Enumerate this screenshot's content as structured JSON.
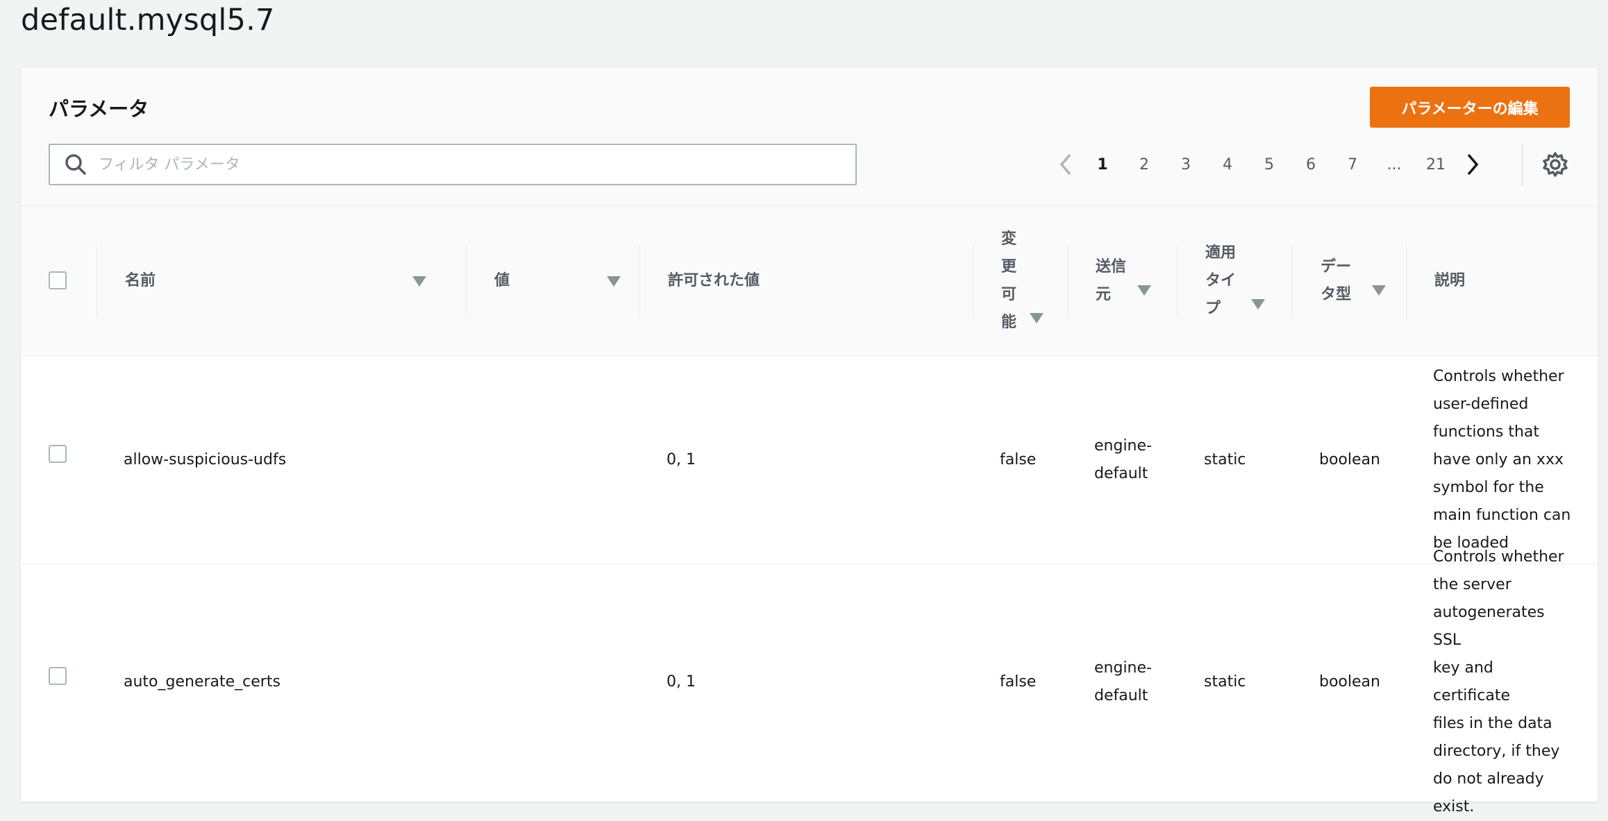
{
  "page": {
    "title": "default.mysql5.7"
  },
  "panel": {
    "title": "パラメータ",
    "edit_button": "パラメーターの編集",
    "search": {
      "placeholder": "フィルタ パラメータ",
      "value": ""
    },
    "pagination": {
      "pages": [
        "1",
        "2",
        "3",
        "4",
        "5",
        "6",
        "7",
        "...",
        "21"
      ],
      "current": "1"
    }
  },
  "table": {
    "columns": {
      "name": "名前",
      "value": "値",
      "allowed": "許可された値",
      "modifiable": [
        "変",
        "更",
        "可",
        "能"
      ],
      "source": [
        "送信",
        "元"
      ],
      "apply_type": [
        "適用",
        "タイ",
        "プ"
      ],
      "data_type": [
        "デー",
        "タ型"
      ],
      "description": "説明"
    },
    "rows": [
      {
        "name": "allow-suspicious-udfs",
        "value": "",
        "allowed": "0, 1",
        "modifiable": "false",
        "source": [
          "engine-",
          "default"
        ],
        "apply_type": "static",
        "data_type": "boolean",
        "description": [
          "Controls whether",
          "user-defined",
          "functions that",
          "have only an xxx",
          "symbol for the",
          "main function can",
          "be loaded"
        ]
      },
      {
        "name": "auto_generate_certs",
        "value": "",
        "allowed": "0, 1",
        "modifiable": "false",
        "source": [
          "engine-",
          "default"
        ],
        "apply_type": "static",
        "data_type": "boolean",
        "description": [
          "Controls whether",
          "the server",
          "autogenerates SSL",
          "key and certificate",
          "files in the data",
          "directory, if they",
          "do not already",
          "exist."
        ]
      }
    ]
  },
  "colors": {
    "accent": "#ec7211",
    "sort_icon": "#879596"
  }
}
